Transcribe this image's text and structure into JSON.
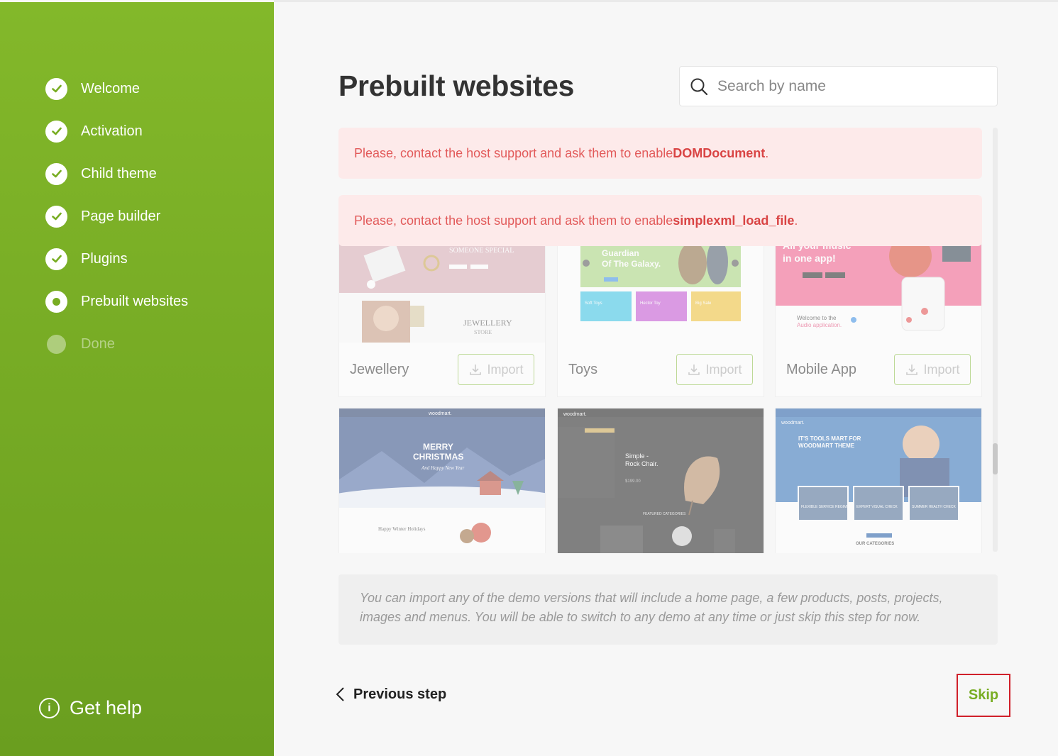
{
  "sidebar": {
    "steps": [
      {
        "label": "Welcome",
        "state": "done"
      },
      {
        "label": "Activation",
        "state": "done"
      },
      {
        "label": "Child theme",
        "state": "done"
      },
      {
        "label": "Page builder",
        "state": "done"
      },
      {
        "label": "Plugins",
        "state": "done"
      },
      {
        "label": "Prebuilt websites",
        "state": "current"
      },
      {
        "label": "Done",
        "state": "pending"
      }
    ],
    "help_label": "Get help"
  },
  "header": {
    "title": "Prebuilt websites",
    "search_placeholder": "Search by name"
  },
  "notices": [
    {
      "text": "Please, contact the host support and ask them to enable ",
      "emphasis": "DOMDocument",
      "suffix": "."
    },
    {
      "text": "Please, contact the host support and ask them to enable ",
      "emphasis": "simplexml_load_file",
      "suffix": "."
    }
  ],
  "demos": [
    {
      "name": "Jewellery",
      "button": "Import",
      "thumb": {
        "tag": "SOMEONE SPECIAL",
        "caption": "JEWELLERY",
        "sub": "STORE"
      }
    },
    {
      "name": "Toys",
      "button": "Import",
      "thumb": {
        "headline": "Guardian",
        "headline2": "Of The Galaxy.",
        "tiles": [
          "Soft Toys",
          "Hector Toy",
          "Big Sale"
        ]
      }
    },
    {
      "name": "Mobile App",
      "button": "Import",
      "thumb": {
        "headline": "All your music",
        "headline2": "in one app!",
        "welcome": "Welcome to the",
        "welcome2": "Audio application."
      }
    },
    {
      "name": "",
      "button": "",
      "thumb": {
        "brand": "woodmart.",
        "headline": "MERRY",
        "headline2": "CHRISTMAS",
        "sub": "And Happy New Year",
        "bottom": "Happy Winter Holidays"
      }
    },
    {
      "name": "",
      "button": "",
      "thumb": {
        "brand": "woodmart.",
        "headline": "Simple -",
        "headline2": "Rock Chair.",
        "price": "$199.00",
        "section": "FEATURED CATEGORIES"
      }
    },
    {
      "name": "",
      "button": "",
      "thumb": {
        "brand": "woodmart.",
        "headline": "IT'S TOOLS MART FOR",
        "headline2": "WOODMART THEME",
        "tiles": [
          "FLEXIBLE SERVICE REGIME",
          "EXPERT VISUAL CHECK",
          "SUMMER HEALTH CHECK"
        ],
        "section": "OUR CATEGORIES"
      }
    }
  ],
  "info_text": "You can import any of the demo versions that will include a home page, a few products, posts, projects, images and menus. You will be able to switch to any demo at any time or just skip this step for now.",
  "footer": {
    "prev_label": "Previous step",
    "skip_label": "Skip"
  },
  "colors": {
    "brand_green": "#78ad23",
    "notice_bg": "#fdeaea",
    "notice_text": "#e25a5a",
    "skip_outline": "#d0202a"
  }
}
